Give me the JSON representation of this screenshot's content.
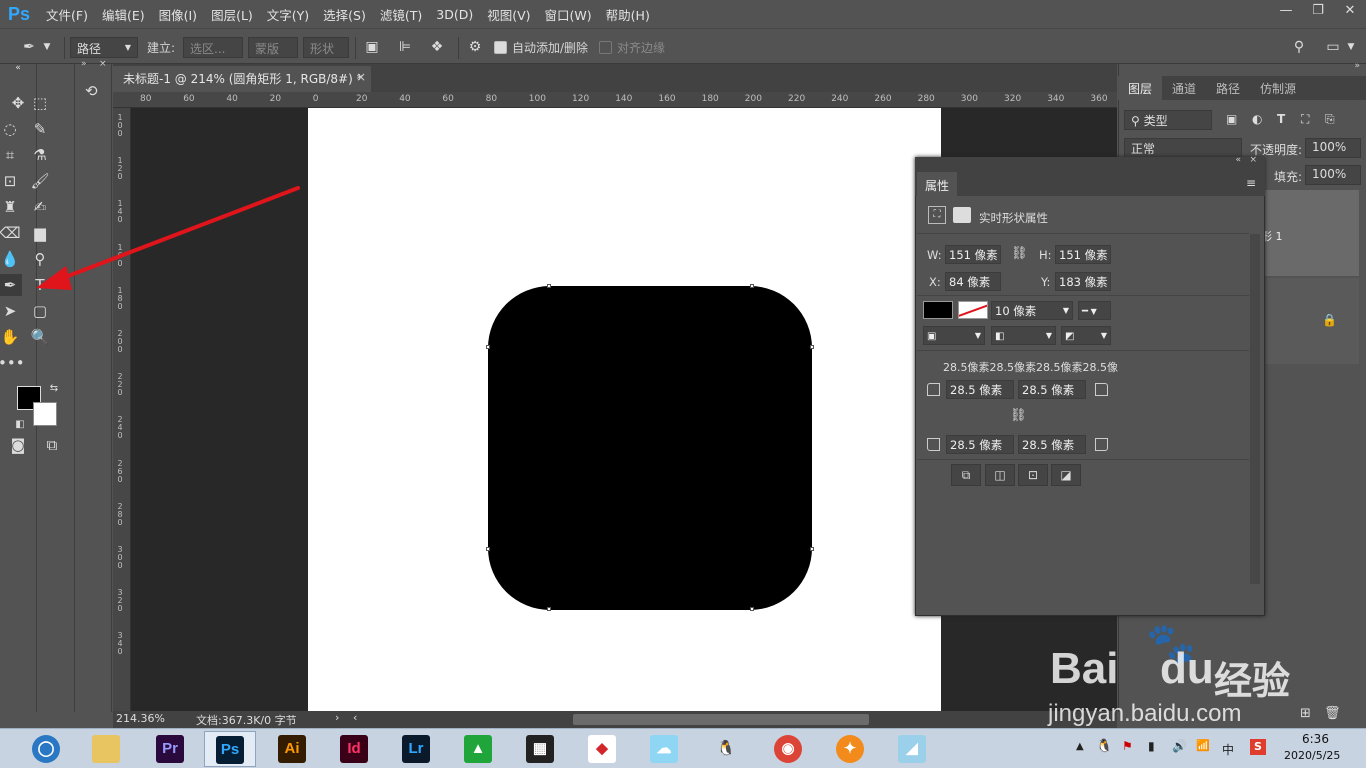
{
  "app": {
    "logo": "Ps"
  },
  "menu": [
    "文件(F)",
    "编辑(E)",
    "图像(I)",
    "图层(L)",
    "文字(Y)",
    "选择(S)",
    "滤镜(T)",
    "3D(D)",
    "视图(V)",
    "窗口(W)",
    "帮助(H)"
  ],
  "window_controls": {
    "minimize": "—",
    "restore": "❐",
    "close": "✕"
  },
  "options": {
    "mode": "路径",
    "make_label": "建立:",
    "selection_btn": "选区...",
    "mask_btn": "蒙版",
    "shape_btn": "形状",
    "auto_add_delete": "自动添加/删除",
    "align_edges": "对齐边缘"
  },
  "document": {
    "tab_title": "未标题-1 @ 214% (圆角矩形 1, RGB/8#) *",
    "close": "×",
    "ruler_h": [
      "80",
      "60",
      "40",
      "20",
      "0",
      "20",
      "40",
      "60",
      "80",
      "100",
      "120",
      "140",
      "160",
      "180",
      "200",
      "220",
      "240",
      "260",
      "280",
      "300",
      "320",
      "340",
      "360"
    ],
    "ruler_v": [
      "1 0 0",
      "1 2 0",
      "1 4 0",
      "1 6 0",
      "1 8 0",
      "2 0 0",
      "2 2 0",
      "2 4 0",
      "2 6 0",
      "2 8 0",
      "3 0 0",
      "3 2 0",
      "3 4 0"
    ]
  },
  "status": {
    "zoom": "214.36%",
    "doc_info": "文档:367.3K/0 字节"
  },
  "layers_panel": {
    "tabs": [
      "图层",
      "通道",
      "路径",
      "仿制源"
    ],
    "filter": "类型",
    "blend_mode": "正常",
    "opacity_label": "不透明度:",
    "opacity_value": "100%",
    "fill_label": "填充:",
    "fill_value": "100%",
    "layer_name_fragment": "形 1"
  },
  "properties_panel": {
    "title": "属性",
    "heading": "实时形状属性",
    "w_label": "W:",
    "w_value": "151 像素",
    "h_label": "H:",
    "h_value": "151 像素",
    "x_label": "X:",
    "x_value": "84 像素",
    "y_label": "Y:",
    "y_value": "183 像素",
    "stroke_width": "10 像素",
    "corner_summary": "28.5像素28.5像素28.5像素28.5像",
    "corner_tl": "28.5 像素",
    "corner_tr": "28.5 像素",
    "corner_bl": "28.5 像素",
    "corner_br": "28.5 像素"
  },
  "taskbar": {
    "apps": [
      "Pr",
      "Ps",
      "Ai",
      "Id",
      "Lr"
    ],
    "time": "6:36",
    "date": "2020/5/25",
    "ime": "中"
  },
  "watermark": {
    "brand": "Bai",
    "brand2": "du",
    "suffix": "经验",
    "url": "jingyan.baidu.com"
  },
  "colors": {
    "ps_blue": "#31a8ff",
    "pr": "#9999ff",
    "ai": "#ff9a00",
    "id": "#ff3366",
    "lr": "#31a8ff",
    "arrow": "#e0141b"
  }
}
